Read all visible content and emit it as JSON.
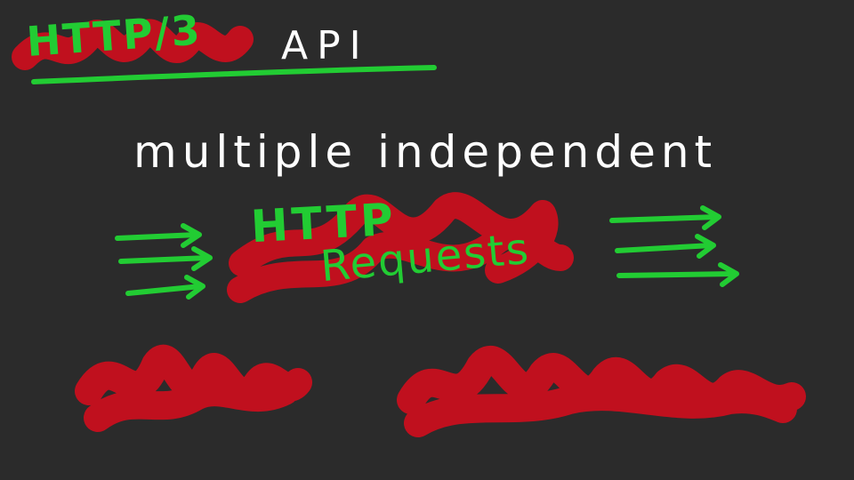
{
  "title": {
    "main": "HTTP/3",
    "suffix": "API"
  },
  "body": {
    "line1": "multiple independent",
    "word_top": "HTTP",
    "word_bottom": "Requests"
  },
  "colors": {
    "background": "#2b2b2b",
    "ink": "#ffffff",
    "accent_green": "#22cc33",
    "scribble_red": "#c0101e"
  },
  "arrows": {
    "left_count": 3,
    "right_count": 3
  },
  "scribbles": {
    "count": 4
  }
}
